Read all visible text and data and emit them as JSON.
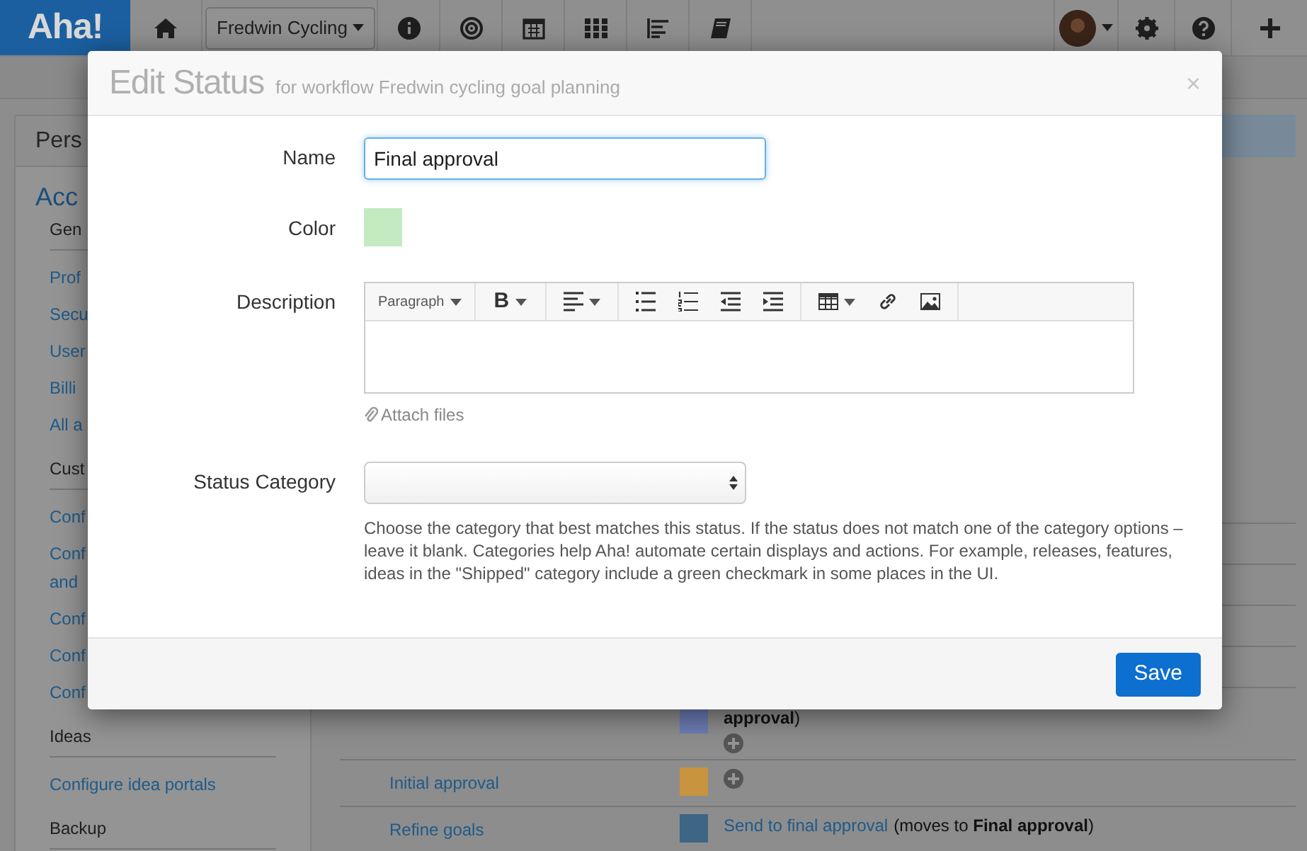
{
  "nav": {
    "logo": "Aha!",
    "product": "Fredwin Cycling"
  },
  "sidebar": {
    "title": "Pers",
    "section": "Acc",
    "items": [
      {
        "kind": "heading",
        "label": "Gen"
      },
      {
        "kind": "link",
        "label": "Prof"
      },
      {
        "kind": "link",
        "label": "Secu"
      },
      {
        "kind": "link",
        "label": "User"
      },
      {
        "kind": "link",
        "label": "Billi"
      },
      {
        "kind": "link",
        "label": "All a"
      },
      {
        "kind": "heading",
        "label": "Cust"
      },
      {
        "kind": "link",
        "label": "Conf"
      },
      {
        "kind": "link",
        "label": "Conf\nand"
      },
      {
        "kind": "link",
        "label": "Conf"
      },
      {
        "kind": "link",
        "label": "Conf"
      },
      {
        "kind": "link",
        "label": "Conf"
      },
      {
        "kind": "heading",
        "label": "Ideas"
      },
      {
        "kind": "link",
        "label": "Configure idea portals"
      },
      {
        "kind": "heading",
        "label": "Backup"
      }
    ]
  },
  "workflow_rows": [
    {
      "color": "#6c7cb4",
      "transition": "**approval**)",
      "can_add": true
    },
    {
      "status": "Initial approval",
      "color": "#c8943f",
      "can_add": true
    },
    {
      "status": "Refine goals",
      "color": "#3d6584",
      "transition_link": "Send to final approval",
      "transition": "(moves to **Final approval**)",
      "can_add": false
    }
  ],
  "dialog": {
    "title": "Edit Status",
    "subtitle": "for workflow Fredwin cycling goal planning",
    "close": "×",
    "name": {
      "label": "Name",
      "value": "Final approval"
    },
    "color": {
      "label": "Color",
      "color": "#c3eac0"
    },
    "description": {
      "label": "Description",
      "toolbar": [
        [
          {
            "kind": "paragraph",
            "label": "Paragraph"
          }
        ],
        [
          {
            "kind": "bold",
            "label": "B"
          }
        ],
        [
          {
            "kind": "align"
          }
        ],
        [
          {
            "kind": "bullets"
          },
          {
            "kind": "numbers"
          },
          {
            "kind": "outdent"
          },
          {
            "kind": "indent"
          }
        ],
        [
          {
            "kind": "table"
          },
          {
            "kind": "link"
          },
          {
            "kind": "image"
          }
        ]
      ],
      "attach": "Attach files"
    },
    "status_category": {
      "label": "Status Category",
      "help": "Choose the category that best matches this status. If the status does not match one of the category options – leave it blank. Categories help Aha! automate certain displays and actions. For example, releases, features, ideas in the \"Shipped\" category include a green checkmark in some places in the UI."
    },
    "save": "Save"
  }
}
